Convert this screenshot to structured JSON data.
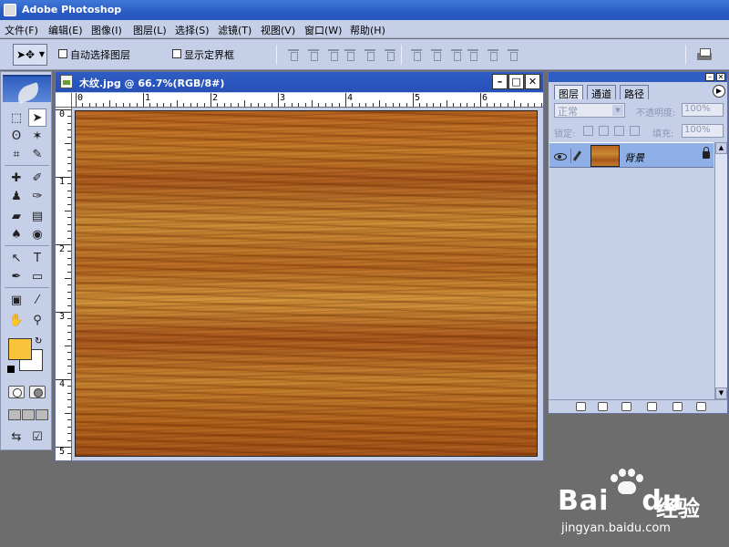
{
  "app": {
    "title": "Adobe Photoshop"
  },
  "menu": [
    "文件(F)",
    "编辑(E)",
    "图像(I)",
    "图层(L)",
    "选择(S)",
    "滤镜(T)",
    "视图(V)",
    "窗口(W)",
    "帮助(H)"
  ],
  "options": {
    "auto_select_layer": "自动选择图层",
    "show_bounding_box": "显示定界框"
  },
  "document": {
    "title": "木纹.jpg @ 66.7%(RGB/8#)",
    "ruler_top": [
      "0",
      "1",
      "2",
      "3",
      "4",
      "5",
      "6"
    ],
    "ruler_left": [
      "0",
      "1",
      "2",
      "3",
      "4",
      "5"
    ]
  },
  "colors": {
    "foreground": "#f9c33b",
    "background": "#ffffff",
    "ui_panel": "#c6cfe8",
    "title_blue": "#2e5dc4"
  },
  "layers_panel": {
    "tabs": [
      "图层",
      "通道",
      "路径"
    ],
    "blend_mode": "正常",
    "opacity_label": "不透明度:",
    "opacity_value": "100%",
    "lock_label": "锁定:",
    "fill_label": "填充:",
    "fill_value": "100%",
    "layer_name": "背景"
  },
  "watermark": {
    "brand": "Bai",
    "brand2": "du",
    "cn": "经验",
    "url": "jingyan.baidu.com"
  }
}
